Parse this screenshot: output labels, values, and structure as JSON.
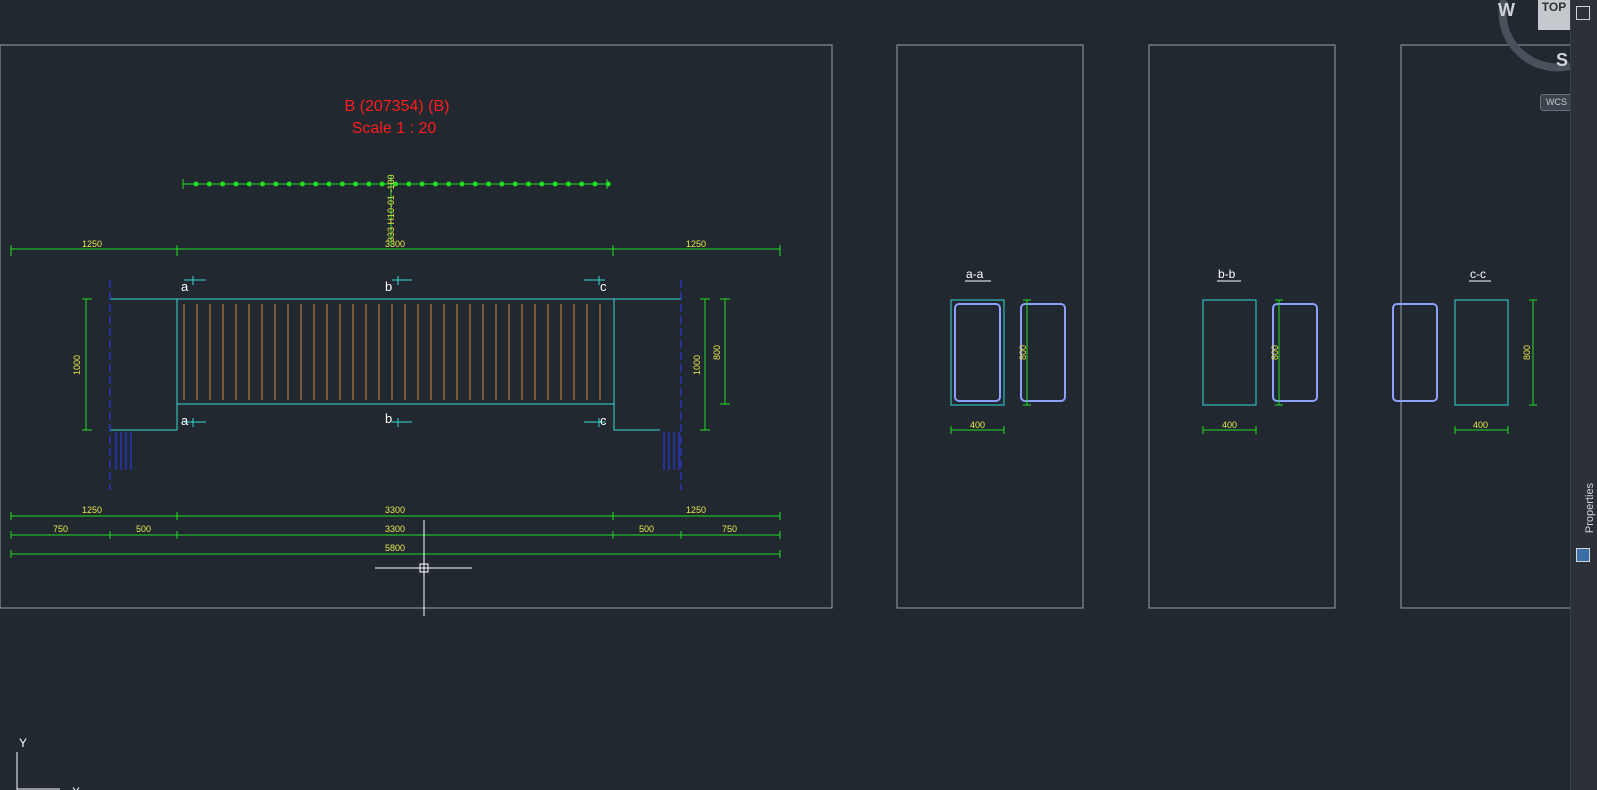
{
  "drawing": {
    "title_line1": "B (207354) (B)",
    "title_line2": "Scale 1 : 20",
    "rebar_label": "333 H10-01 -100",
    "top_dims": [
      "1250",
      "3300",
      "1250"
    ],
    "bottom_dims_row1": [
      "1250",
      "3300",
      "1250"
    ],
    "bottom_dims_row2": [
      "750",
      "500",
      "3300",
      "500",
      "750"
    ],
    "bottom_dims_row3": [
      "5800"
    ],
    "left_height": "1000",
    "right_height": "1000",
    "right_height_inner": "800",
    "section_marks": {
      "top": [
        "a",
        "b",
        "c"
      ],
      "bottom": [
        "a",
        "b",
        "c"
      ]
    }
  },
  "sections": [
    {
      "label": "a-a",
      "height_dim": "800",
      "width_dim": "400"
    },
    {
      "label": "b-b",
      "height_dim": "800",
      "width_dim": "400"
    },
    {
      "label": "c-c",
      "height_dim": "800",
      "width_dim": "400"
    }
  ],
  "ui": {
    "viewcube_top": "TOP",
    "compass_w": "W",
    "compass_s": "S",
    "wcs_label": "WCS",
    "properties_label": "Properties",
    "ucs_y": "Y",
    "ucs_x": "X"
  },
  "colors": {
    "background": "#212830",
    "dimension_green": "#22dd22",
    "dimension_text": "#e8e84a",
    "beam_outline": "#36d6d6",
    "stirrup_orange": "#d28a45",
    "section_rebar": "#8ca0ff",
    "title_red": "#ff1c1c",
    "hidden_blue": "#2a3cff",
    "frame_gray": "#9aa0a8"
  }
}
